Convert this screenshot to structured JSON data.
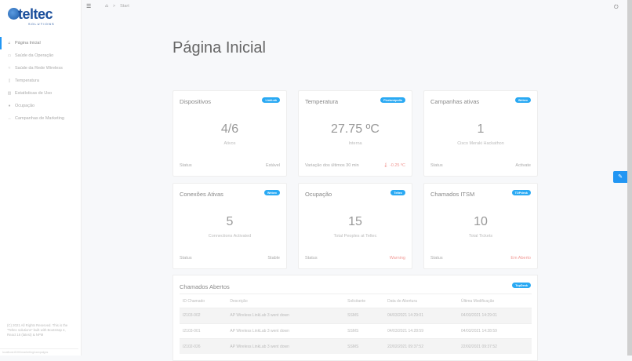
{
  "brand": {
    "name": "teltec",
    "tagline": "SOLUTIONS"
  },
  "sidebar": {
    "items": [
      {
        "label": "Página Inicial",
        "icon": "home-icon",
        "glyph": "⌂"
      },
      {
        "label": "Saúde da Operação",
        "icon": "monitor-icon",
        "glyph": "▭"
      },
      {
        "label": "Saúde da Rede Wireless",
        "icon": "wifi-icon",
        "glyph": "≈"
      },
      {
        "label": "Temperatura",
        "icon": "thermometer-icon",
        "glyph": "▯"
      },
      {
        "label": "Estatísticas de Uso",
        "icon": "chart-icon",
        "glyph": "▥"
      },
      {
        "label": "Ocupação",
        "icon": "circle-icon",
        "glyph": "●"
      },
      {
        "label": "Campanhas de Marketing",
        "icon": "broadcast-icon",
        "glyph": "↔"
      }
    ],
    "copyright": "(C) 2021 All Rights Reserved. This is the \"Teltec solutions\" built with Bootstrap 4, React 16 (latest) & NPM",
    "footer": "localhost:8100/marketing/campaigns"
  },
  "breadcrumb": {
    "current": "Start"
  },
  "page_title": "Página Inicial",
  "cards": [
    {
      "title": "Dispositivos",
      "badge": "LinkLab",
      "value": "4/6",
      "sub": "Ativos",
      "left": "Status",
      "right": "Estável",
      "warn": false
    },
    {
      "title": "Temperatura",
      "badge": "Florianópolis",
      "value": "27.75 ºC",
      "sub": "Interna",
      "left": "Variação dos últimos 30 min",
      "right": "🌡 -0.25 ºC",
      "warn": true
    },
    {
      "title": "Campanhas ativas",
      "badge": "Webex",
      "value": "1",
      "sub": "Cisco Meraki Hackathon",
      "left": "Status",
      "right": "Activate",
      "warn": false
    },
    {
      "title": "Conexões Ativas",
      "badge": "Webex",
      "value": "5",
      "sub": "Connections Activated",
      "left": "Status",
      "right": "Stable",
      "warn": false
    },
    {
      "title": "Ocupação",
      "badge": "Teltec",
      "value": "15",
      "sub": "Total Peoples at Teltec",
      "left": "Status",
      "right": "Warning",
      "warn": true
    },
    {
      "title": "Chamados ITSM",
      "badge": "TOPdesk",
      "value": "10",
      "sub": "Total Tickets",
      "left": "Status",
      "right": "Em Aberto",
      "warn": true
    }
  ],
  "tickets": {
    "title": "Chamados Abertos",
    "badge": "TopDesk",
    "headers": [
      "ID Chamado",
      "Descrição",
      "Solicitante",
      "Data de Abertura",
      "Última Modificação"
    ],
    "rows": [
      [
        "I2103-002",
        "AP Wireless LinkLab 3 went down",
        "SSMS",
        "04/03/2021 14:29:01",
        "04/03/2021 14:29:01"
      ],
      [
        "I2103-001",
        "AP Wireless LinkLab 3 went down",
        "SSMS",
        "04/03/2021 14:28:59",
        "04/03/2021 14:28:59"
      ],
      [
        "I2102-026",
        "AP Wireless LinkLab 3 went down",
        "SSMS",
        "22/02/2021 09:37:52",
        "22/02/2021 09:37:52"
      ]
    ]
  },
  "colors": {
    "accent": "#2196f3",
    "badge": "#2aa9f3",
    "warning": "#f19a96"
  }
}
